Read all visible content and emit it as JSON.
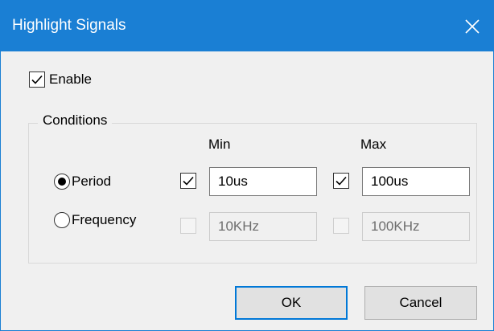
{
  "window": {
    "title": "Highlight Signals",
    "close_icon": "close-icon"
  },
  "enable": {
    "label": "Enable",
    "checked": true
  },
  "conditions": {
    "group_label": "Conditions",
    "min_header": "Min",
    "max_header": "Max",
    "period": {
      "label": "Period",
      "selected": true,
      "min_checked": true,
      "min_value": "10us",
      "max_checked": true,
      "max_value": "100us"
    },
    "frequency": {
      "label": "Frequency",
      "selected": false,
      "min_checked": false,
      "min_value": "10KHz",
      "max_checked": false,
      "max_value": "100KHz"
    }
  },
  "buttons": {
    "ok": "OK",
    "cancel": "Cancel"
  },
  "colors": {
    "titlebar": "#1a7fd4",
    "focus_border": "#0078d7",
    "dialog_bg": "#f0f0f0"
  }
}
